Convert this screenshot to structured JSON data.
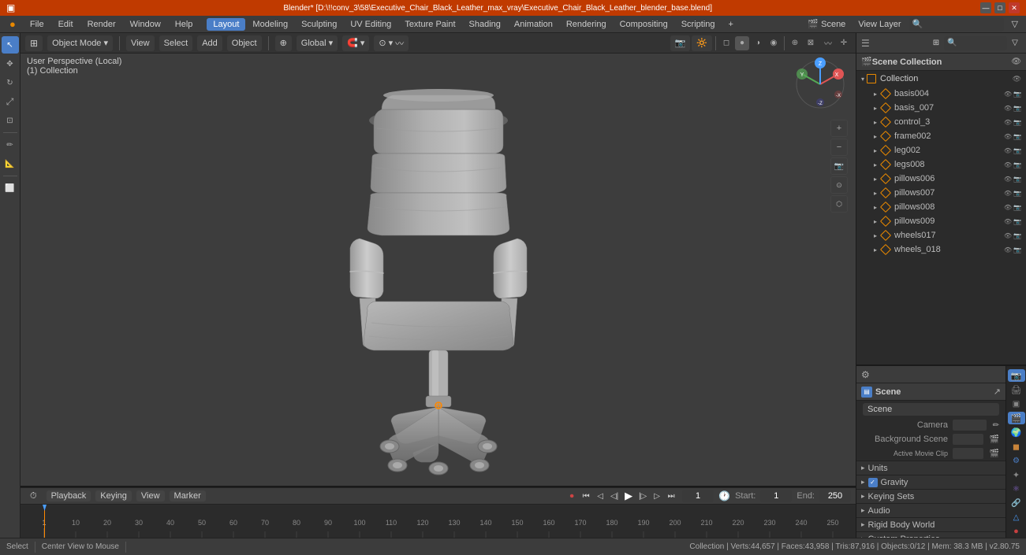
{
  "titlebar": {
    "title": "Blender* [D:\\!!conv_3\\58\\Executive_Chair_Black_Leather_max_vray\\Executive_Chair_Black_Leather_blender_base.blend]",
    "min": "—",
    "max": "□",
    "close": "✕"
  },
  "menubar": {
    "items": [
      "Blender",
      "File",
      "Edit",
      "Render",
      "Window",
      "Help",
      "Layout",
      "Modeling",
      "Sculpting",
      "UV Editing",
      "Texture Paint",
      "Shading",
      "Animation",
      "Rendering",
      "Compositing",
      "Scripting",
      "+"
    ]
  },
  "viewport": {
    "mode": "Object Mode",
    "view_menu": "View",
    "select_menu": "Select",
    "add_menu": "Add",
    "object_menu": "Object",
    "transform": "Global",
    "info_line1": "User Perspective (Local)",
    "info_line2": "(1) Collection"
  },
  "outliner": {
    "header": "Scene Collection",
    "collection": "Collection",
    "items": [
      {
        "name": "basis004",
        "selected": false
      },
      {
        "name": "basis_007",
        "selected": false
      },
      {
        "name": "control_3",
        "selected": false
      },
      {
        "name": "frame002",
        "selected": false
      },
      {
        "name": "leg002",
        "selected": false
      },
      {
        "name": "legs008",
        "selected": false
      },
      {
        "name": "pillows006",
        "selected": false
      },
      {
        "name": "pillows007",
        "selected": false
      },
      {
        "name": "pillows008",
        "selected": false
      },
      {
        "name": "pillows009",
        "selected": false
      },
      {
        "name": "wheels017",
        "selected": false
      },
      {
        "name": "wheels_018",
        "selected": false
      }
    ]
  },
  "properties": {
    "scene_label": "Scene",
    "scene_name": "Scene",
    "camera_label": "Camera",
    "camera_value": "",
    "background_label": "Background Scene",
    "background_value": "",
    "movie_clip_label": "Active Movie Clip",
    "movie_clip_value": "",
    "sections": [
      {
        "label": "Units",
        "collapsed": true
      },
      {
        "label": "Gravity",
        "collapsed": false,
        "checkbox": true
      },
      {
        "label": "Keying Sets",
        "collapsed": true
      },
      {
        "label": "Audio",
        "collapsed": true
      },
      {
        "label": "Rigid Body World",
        "collapsed": true
      },
      {
        "label": "Custom Properties",
        "collapsed": true
      }
    ]
  },
  "timeline": {
    "playback_label": "Playback",
    "keying_label": "Keying",
    "view_label": "View",
    "marker_label": "Marker",
    "current_frame": "1",
    "start_label": "Start:",
    "start_value": "1",
    "end_label": "End:",
    "end_value": "250",
    "ruler_marks": [
      "0",
      "10",
      "20",
      "30",
      "40",
      "50",
      "60",
      "70",
      "80",
      "90",
      "100",
      "110",
      "120",
      "130",
      "140",
      "150",
      "160",
      "170",
      "180",
      "190",
      "200",
      "210",
      "220",
      "230",
      "240",
      "250"
    ]
  },
  "statusbar": {
    "select": "Select",
    "center": "Center View to Mouse",
    "collection": "Collection | Verts:44,657 | Faces:43,958 | Tris:87,916 | Objects:0/12 | Mem: 38.3 MB | v2.80.75"
  },
  "icons": {
    "cursor": "↖",
    "move": "✥",
    "rotate": "↻",
    "scale": "⤢",
    "transform": "⊞",
    "annotate": "✏",
    "measure": "⌶",
    "menu_up": "▲"
  }
}
